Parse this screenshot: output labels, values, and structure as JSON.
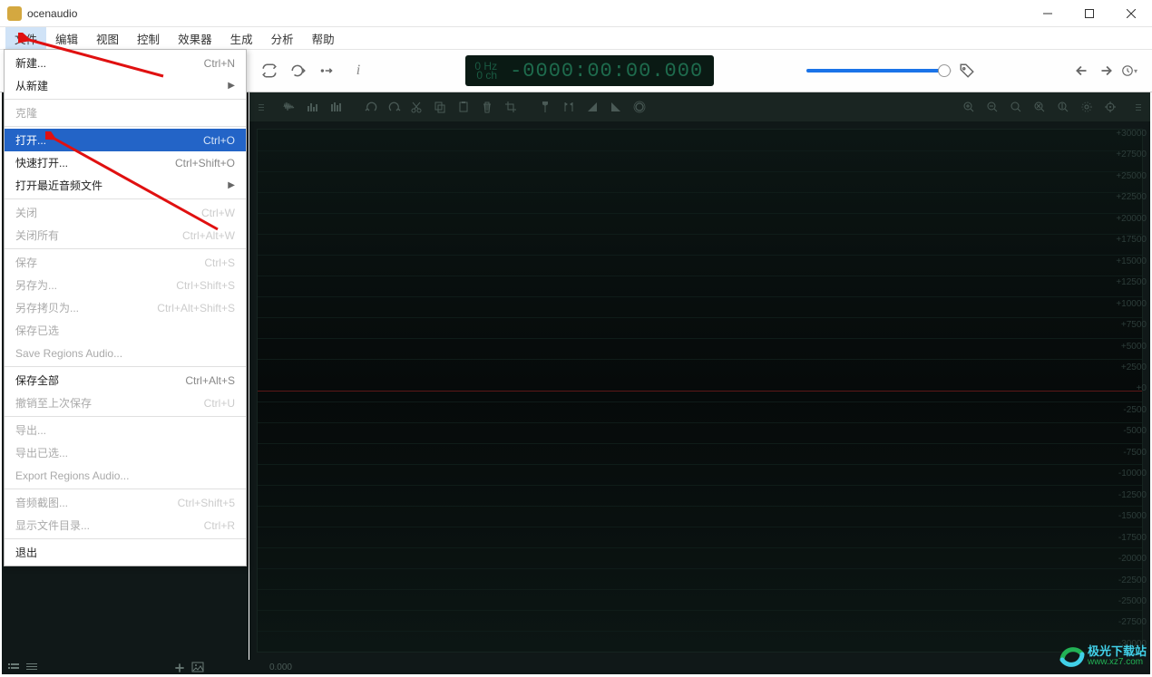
{
  "title": "ocenaudio",
  "menubar": [
    "文件",
    "编辑",
    "视图",
    "控制",
    "效果器",
    "生成",
    "分析",
    "帮助"
  ],
  "lcd_hz": "0 Hz",
  "lcd_ch": "0 ch",
  "lcd_time": "-0000:00:00.000",
  "status_pos": "0.000",
  "watermark_title": "极光下载站",
  "watermark_url": "www.xz7.com",
  "scale": [
    "+30000",
    "+27500",
    "+25000",
    "+22500",
    "+20000",
    "+17500",
    "+15000",
    "+12500",
    "+10000",
    "+7500",
    "+5000",
    "+2500",
    "+0",
    "-2500",
    "-5000",
    "-7500",
    "-10000",
    "-12500",
    "-15000",
    "-17500",
    "-20000",
    "-22500",
    "-25000",
    "-27500",
    "-30000"
  ],
  "file_menu": [
    {
      "label": "新建...",
      "shortcut": "Ctrl+N",
      "disabled": false
    },
    {
      "label": "从新建",
      "shortcut": "",
      "disabled": false,
      "sub": true
    },
    {
      "sep": true
    },
    {
      "label": "克隆",
      "shortcut": "",
      "disabled": true
    },
    {
      "sep": true
    },
    {
      "label": "打开...",
      "shortcut": "Ctrl+O",
      "disabled": false,
      "highlight": true
    },
    {
      "label": "快速打开...",
      "shortcut": "Ctrl+Shift+O",
      "disabled": false
    },
    {
      "label": "打开最近音频文件",
      "shortcut": "",
      "disabled": false,
      "sub": true
    },
    {
      "sep": true
    },
    {
      "label": "关闭",
      "shortcut": "Ctrl+W",
      "disabled": true
    },
    {
      "label": "关闭所有",
      "shortcut": "Ctrl+Alt+W",
      "disabled": true
    },
    {
      "sep": true
    },
    {
      "label": "保存",
      "shortcut": "Ctrl+S",
      "disabled": true
    },
    {
      "label": "另存为...",
      "shortcut": "Ctrl+Shift+S",
      "disabled": true
    },
    {
      "label": "另存拷贝为...",
      "shortcut": "Ctrl+Alt+Shift+S",
      "disabled": true
    },
    {
      "label": "保存已选",
      "shortcut": "",
      "disabled": true
    },
    {
      "label": "Save Regions Audio...",
      "shortcut": "",
      "disabled": true
    },
    {
      "sep": true
    },
    {
      "label": "保存全部",
      "shortcut": "Ctrl+Alt+S",
      "disabled": false
    },
    {
      "label": "撤销至上次保存",
      "shortcut": "Ctrl+U",
      "disabled": true
    },
    {
      "sep": true
    },
    {
      "label": "导出...",
      "shortcut": "",
      "disabled": true
    },
    {
      "label": "导出已选...",
      "shortcut": "",
      "disabled": true
    },
    {
      "label": "Export Regions Audio...",
      "shortcut": "",
      "disabled": true
    },
    {
      "sep": true
    },
    {
      "label": "音频截图...",
      "shortcut": "Ctrl+Shift+5",
      "disabled": true
    },
    {
      "label": "显示文件目录...",
      "shortcut": "Ctrl+R",
      "disabled": true
    },
    {
      "sep": true
    },
    {
      "label": "退出",
      "shortcut": "",
      "disabled": false
    }
  ]
}
